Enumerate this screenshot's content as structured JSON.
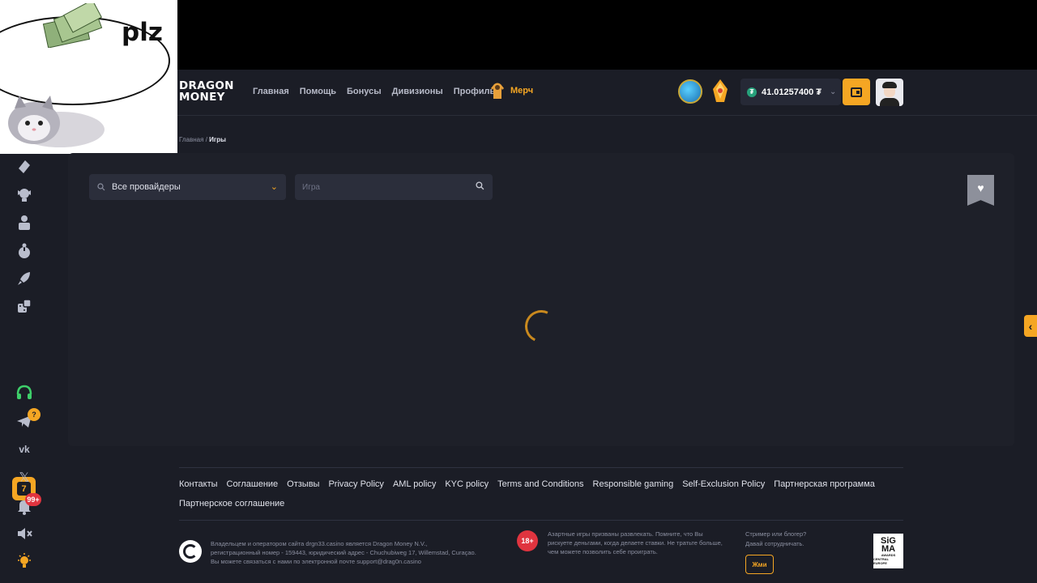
{
  "meme": {
    "caption": "plz"
  },
  "header": {
    "logo_line1": "DRAGON",
    "logo_line2": "MONEY",
    "nav": [
      "Главная",
      "Помощь",
      "Бонусы",
      "Дивизионы",
      "Профиль"
    ],
    "merch_label": "Мерч",
    "balance": "41.01257400",
    "currency_icon": "tether-icon",
    "accent": "#f5a623"
  },
  "breadcrumb": {
    "home": "Главная",
    "sep": "/",
    "current": "Игры"
  },
  "filters": {
    "provider_label": "Все провайдеры",
    "search_placeholder": "Игра"
  },
  "sidebar": {
    "telegram_badge": "?",
    "notifications_badge": "99+"
  },
  "footer": {
    "links": [
      "Контакты",
      "Соглашение",
      "Отзывы",
      "Privacy Policy",
      "AML policy",
      "KYC policy",
      "Terms and Conditions",
      "Responsible gaming",
      "Self-Exclusion Policy",
      "Партнерская программа",
      "Партнерское соглашение"
    ],
    "legal_line1": "Владельцем и оператором сайта drgn33.casino является Dragon Money N.V.,",
    "legal_line2": "регистрационный номер - 159443, юридический адрес - Chuchubiweg 17, Willemstad, Curaçao.",
    "legal_line3": "Вы можете связаться с нами по электронной почте support@drag0n.casino",
    "age_badge": "18+",
    "warning": "Азартные игры призваны развлекать. Помните, что Вы рискуете деньгами, когда делаете ставки. Не тратьте больше, чем можете позволить себе проиграть.",
    "streamer_line1": "Стример или блогер?",
    "streamer_line2": "Давай сотрудничать.",
    "streamer_button": "Жми",
    "sigma_line1": "SiG",
    "sigma_line2": "MA",
    "sigma_line3": "AWARDS",
    "sigma_line4": "CENTRAL EUROPE"
  }
}
